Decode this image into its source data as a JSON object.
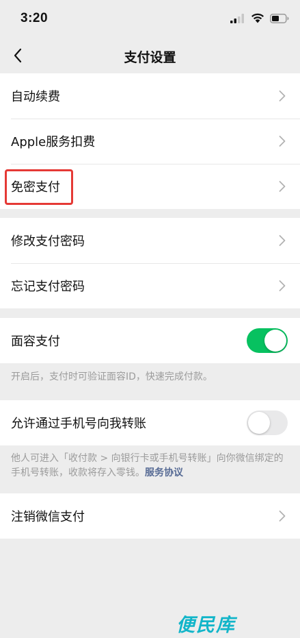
{
  "status_bar": {
    "time": "3:20"
  },
  "nav": {
    "title": "支付设置"
  },
  "groups": {
    "billing": [
      {
        "label": "自动续费"
      },
      {
        "label": "Apple服务扣费"
      },
      {
        "label": "免密支付"
      }
    ],
    "password": [
      {
        "label": "修改支付密码"
      },
      {
        "label": "忘记支付密码"
      }
    ],
    "face_pay": {
      "label": "面容支付",
      "enabled": true,
      "description": "开启后，支付时可验证面容ID，快速完成付款。"
    },
    "phone_transfer": {
      "label": "允许通过手机号向我转账",
      "enabled": false,
      "description": "他人可进入「收付款 > 向银行卡或手机号转账」向你微信绑定的手机号转账，收款将存入零钱。",
      "link": "服务协议"
    },
    "cancel": {
      "label": "注销微信支付"
    }
  },
  "watermark": "便民库",
  "colors": {
    "toggle_on": "#07c160",
    "highlight": "#e53935",
    "link": "#576b95",
    "watermark": "#11b5c9"
  },
  "icons": {
    "back": "chevron-left-icon",
    "row_arrow": "chevron-right-icon",
    "signal": "signal-icon",
    "wifi": "wifi-icon",
    "battery": "battery-icon"
  }
}
